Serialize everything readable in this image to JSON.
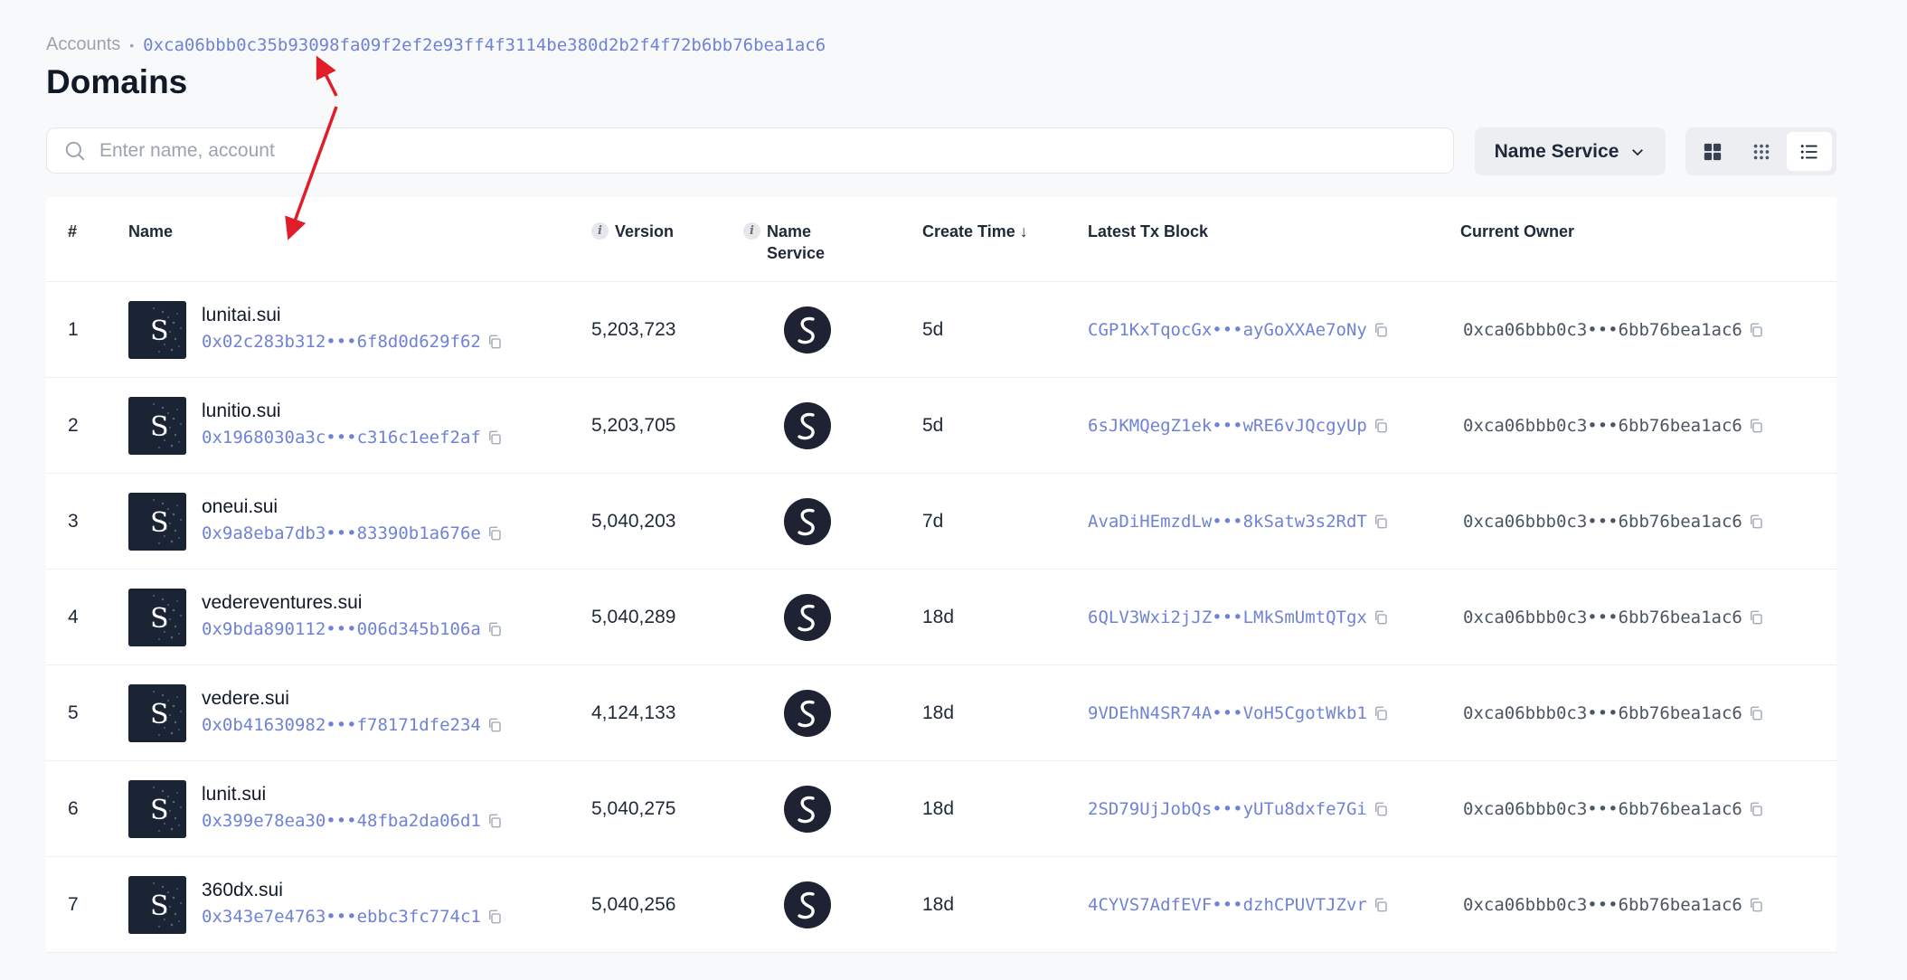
{
  "breadcrumb": {
    "root": "Accounts",
    "separator": "•",
    "address": "0xca06bbb0c35b93098fa09f2ef2e93ff4f3114be380d2b2f4f72b6bb76bea1ac6"
  },
  "page_title": "Domains",
  "search": {
    "placeholder": "Enter name, account",
    "value": ""
  },
  "filter": {
    "label": "Name Service"
  },
  "view_modes": [
    "grid-large-icon",
    "grid-small-icon",
    "list-icon"
  ],
  "table": {
    "headers": {
      "num": "#",
      "name": "Name",
      "version": "Version",
      "name_service_line1": "Name",
      "name_service_line2": "Service",
      "create_time": "Create Time ↓",
      "latest_tx": "Latest Tx Block",
      "owner": "Current Owner"
    },
    "rows": [
      {
        "num": "1",
        "name": "lunitai.sui",
        "id": "0x02c283b312•••6f8d0d629f62",
        "version": "5,203,723",
        "time": "5d",
        "tx": "CGP1KxTqocGx•••ayGoXXAe7oNy",
        "owner": "0xca06bbb0c3•••6bb76bea1ac6"
      },
      {
        "num": "2",
        "name": "lunitio.sui",
        "id": "0x1968030a3c•••c316c1eef2af",
        "version": "5,203,705",
        "time": "5d",
        "tx": "6sJKMQegZ1ek•••wRE6vJQcgyUp",
        "owner": "0xca06bbb0c3•••6bb76bea1ac6"
      },
      {
        "num": "3",
        "name": "oneui.sui",
        "id": "0x9a8eba7db3•••83390b1a676e",
        "version": "5,040,203",
        "time": "7d",
        "tx": "AvaDiHEmzdLw•••8kSatw3s2RdT",
        "owner": "0xca06bbb0c3•••6bb76bea1ac6"
      },
      {
        "num": "4",
        "name": "vedereventures.sui",
        "id": "0x9bda890112•••006d345b106a",
        "version": "5,040,289",
        "time": "18d",
        "tx": "6QLV3Wxi2jJZ•••LMkSmUmtQTgx",
        "owner": "0xca06bbb0c3•••6bb76bea1ac6"
      },
      {
        "num": "5",
        "name": "vedere.sui",
        "id": "0x0b41630982•••f78171dfe234",
        "version": "4,124,133",
        "time": "18d",
        "tx": "9VDEhN4SR74A•••VoH5CgotWkb1",
        "owner": "0xca06bbb0c3•••6bb76bea1ac6"
      },
      {
        "num": "6",
        "name": "lunit.sui",
        "id": "0x399e78ea30•••48fba2da06d1",
        "version": "5,040,275",
        "time": "18d",
        "tx": "2SD79UjJobQs•••yUTu8dxfe7Gi",
        "owner": "0xca06bbb0c3•••6bb76bea1ac6"
      },
      {
        "num": "7",
        "name": "360dx.sui",
        "id": "0x343e7e4763•••ebbc3fc774c1",
        "version": "5,040,256",
        "time": "18d",
        "tx": "4CYVS7AdfEVF•••dzhCPUVTJZvr",
        "owner": "0xca06bbb0c3•••6bb76bea1ac6"
      }
    ]
  },
  "colors": {
    "accent": "#6f82d6",
    "annotation_arrow": "#e11d2a",
    "ns_logo_bg": "#1e2232"
  }
}
